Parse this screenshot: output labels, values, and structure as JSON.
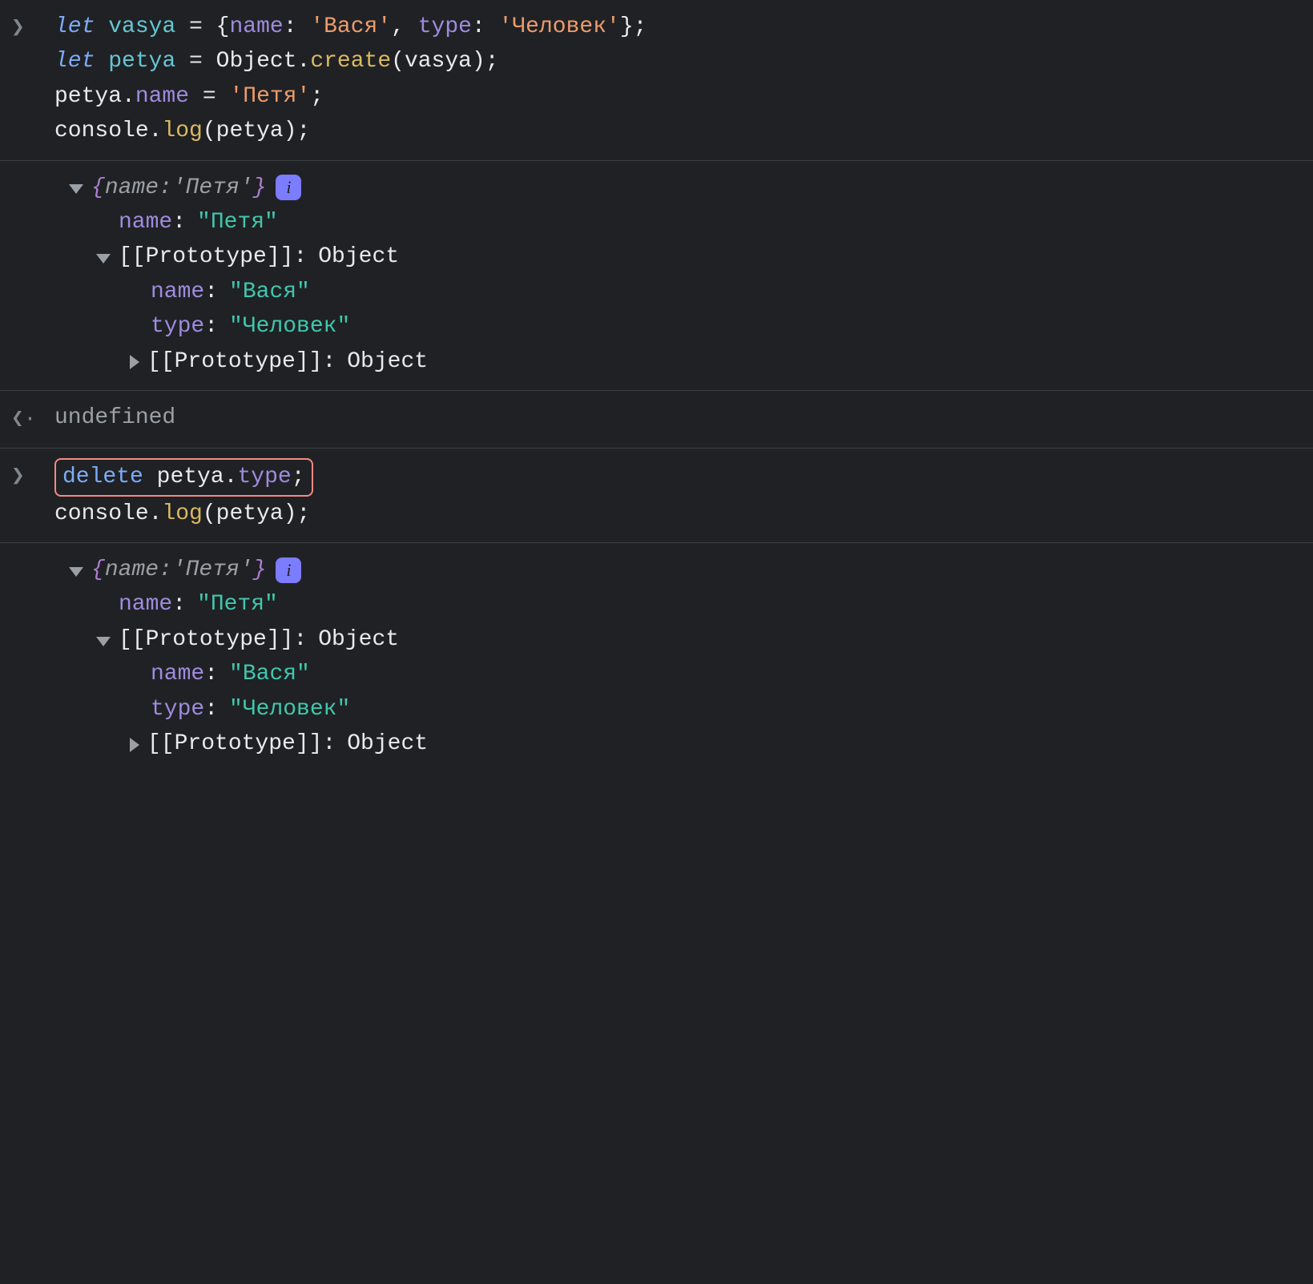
{
  "icons": {
    "input_prompt": "❯",
    "return_prompt": "❮·",
    "info": "i"
  },
  "code1": {
    "line1": {
      "let": "let",
      "sp": " ",
      "vasya": "vasya",
      "eq": " = ",
      "lb": "{",
      "name": "name",
      "c1": ": ",
      "str1": "'Вася'",
      "comma": ", ",
      "type": "type",
      "c2": ": ",
      "str2": "'Человек'",
      "rb": "}",
      "semi": ";"
    },
    "line2": {
      "let": "let",
      "sp": " ",
      "petya": "petya",
      "eq": " = ",
      "Object": "Object",
      "dot": ".",
      "create": "create",
      "lp": "(",
      "vasya": "vasya",
      "rp": ")",
      "semi": ";"
    },
    "line3": {
      "petya": "petya",
      "dot": ".",
      "name": "name",
      "eq": " = ",
      "str": "'Петя'",
      "semi": ";"
    },
    "line4": {
      "console": "console",
      "dot": ".",
      "log": "log",
      "lp": "(",
      "petya": "petya",
      "rp": ")",
      "semi": ";"
    }
  },
  "output1": {
    "summary": {
      "lb": "{",
      "key": "name:",
      "sp": " ",
      "val": "'Петя'",
      "rb": "}"
    },
    "name": {
      "key": "name",
      "val": "\"Петя\""
    },
    "proto": {
      "key": "[[Prototype]]",
      "val": "Object"
    },
    "proto_name": {
      "key": "name",
      "val": "\"Вася\""
    },
    "proto_type": {
      "key": "type",
      "val": "\"Человек\""
    },
    "proto2": {
      "key": "[[Prototype]]",
      "val": "Object"
    }
  },
  "return1": "undefined",
  "code2": {
    "line1": {
      "delete": "delete",
      "sp": " ",
      "petya": "petya",
      "dot": ".",
      "type": "type",
      "semi": ";"
    },
    "line2": {
      "console": "console",
      "dot": ".",
      "log": "log",
      "lp": "(",
      "petya": "petya",
      "rp": ")",
      "semi": ";"
    }
  },
  "output2": {
    "summary": {
      "lb": "{",
      "key": "name:",
      "sp": " ",
      "val": "'Петя'",
      "rb": "}"
    },
    "name": {
      "key": "name",
      "val": "\"Петя\""
    },
    "proto": {
      "key": "[[Prototype]]",
      "val": "Object"
    },
    "proto_name": {
      "key": "name",
      "val": "\"Вася\""
    },
    "proto_type": {
      "key": "type",
      "val": "\"Человек\""
    },
    "proto2": {
      "key": "[[Prototype]]",
      "val": "Object"
    }
  }
}
